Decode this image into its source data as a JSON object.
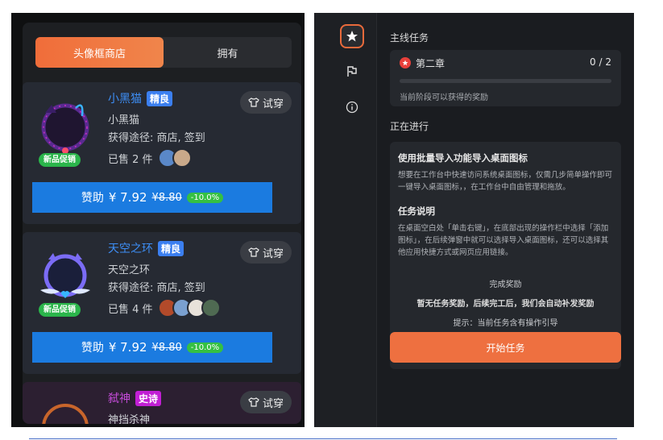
{
  "shop": {
    "tabs": [
      {
        "label": "头像框商店",
        "active": true
      },
      {
        "label": "拥有",
        "active": false
      }
    ],
    "items": [
      {
        "name": "小黑猫",
        "rarity": "精良",
        "try_label": "试穿",
        "subtitle": "小黑猫",
        "source": "获得途径: 商店, 签到",
        "owned": "已售 2 件",
        "promo": "新品促销",
        "buy_label": "赞助",
        "price": "¥ 7.92",
        "old_price": "¥8.80",
        "discount": "-10.0%"
      },
      {
        "name": "天空之环",
        "rarity": "精良",
        "try_label": "试穿",
        "subtitle": "天空之环",
        "source": "获得途径: 商店, 签到",
        "owned": "已售 4 件",
        "promo": "新品促销",
        "buy_label": "赞助",
        "price": "¥ 7.92",
        "old_price": "¥8.80",
        "discount": "-10.0%"
      },
      {
        "name": "弑神",
        "rarity": "史诗",
        "try_label": "试穿",
        "subtitle": "神挡杀神"
      }
    ]
  },
  "tasks": {
    "rail_icons": [
      "star-icon",
      "flag-icon",
      "info-icon"
    ],
    "main_title": "主线任务",
    "chapter": {
      "name": "第二章",
      "count": "0 / 2",
      "progress": 0,
      "hint": "当前阶段可以获得的奖励"
    },
    "in_progress_title": "正在进行",
    "task": {
      "title": "使用批量导入功能导入桌面图标",
      "desc": "想要在工作台中快速访问系统桌面图标，仅需几步简单操作即可一键导入桌面图标，，在工作台中自由管理和拖放。",
      "howto_title": "任务说明",
      "howto": "在桌面空白处「单击右键」，在底部出现的操作栏中选择「添加图标」，在后续弹窗中就可以选择导入桌面图标，还可以选择其他应用快捷方式或网页应用链接。",
      "reward_title": "完成奖励",
      "reward_none": "暂无任务奖励，后续完工后，我们会自动补发奖励",
      "tip": "提示：当前任务含有操作引导",
      "start_label": "开始任务"
    }
  },
  "colors": {
    "accent": "#ee7040",
    "buy_blue": "#1b7be0",
    "rare_blue": "#3b7ff0",
    "epic_purple": "#c11fd4",
    "promo_green": "#2bb54b"
  }
}
